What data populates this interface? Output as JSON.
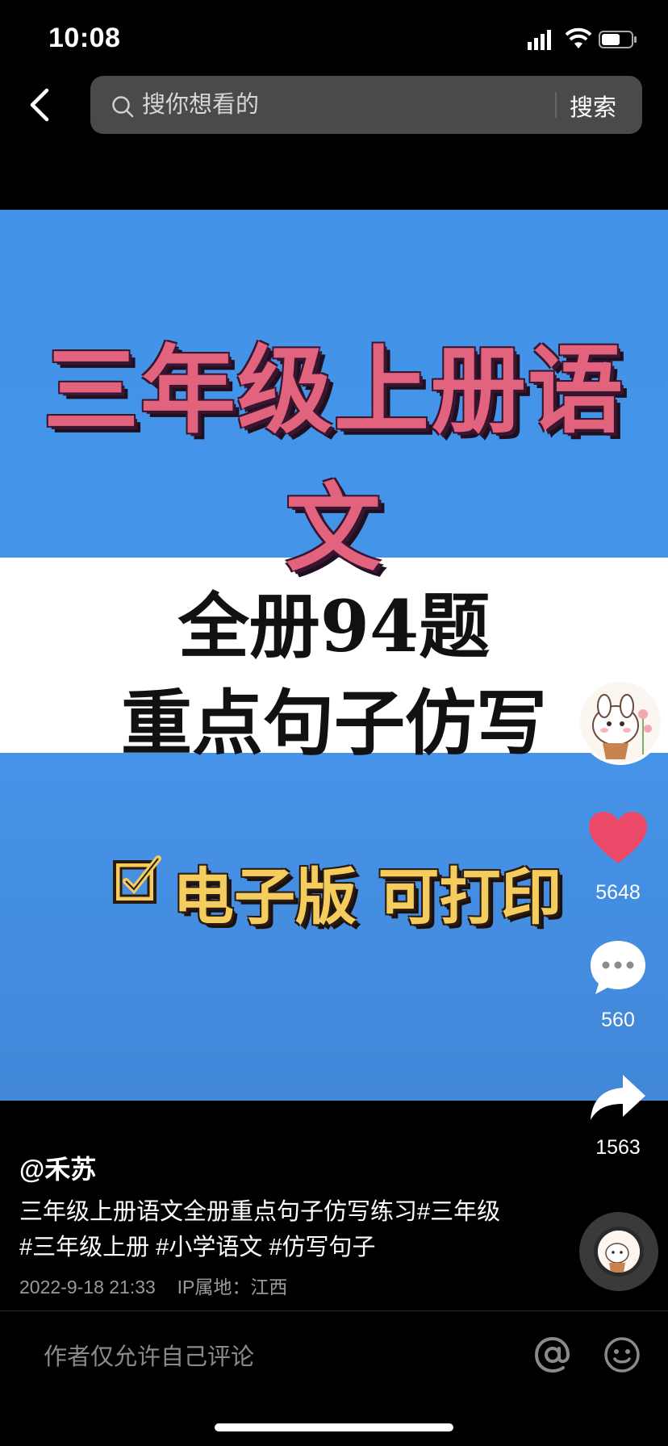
{
  "status_bar": {
    "time": "10:08"
  },
  "search": {
    "placeholder": "搜你想看的",
    "button_label": "搜索"
  },
  "cover": {
    "title": "三年级上册语文",
    "subtitle_line1": "全册94题",
    "subtitle_line2": "重点句子仿写",
    "badge": "电子版 可打印",
    "colors": {
      "background": "#4294e8",
      "title": "#e2637d",
      "badge": "#f4cd5e"
    }
  },
  "actions": {
    "likes": "5648",
    "comments": "560",
    "shares": "1563"
  },
  "post": {
    "author": "@禾苏",
    "description": "三年级上册语文全册重点句子仿写练习#三年级 #三年级上册 #小学语文 #仿写句子",
    "date": "2022-9-18 21:33",
    "ip_location": "IP属地：江西"
  },
  "comment_bar": {
    "placeholder": "作者仅允许自己评论"
  },
  "icons": [
    "chevron-left-icon",
    "search-icon",
    "heart-icon",
    "comment-icon",
    "share-icon",
    "at-icon",
    "emoji-icon"
  ]
}
